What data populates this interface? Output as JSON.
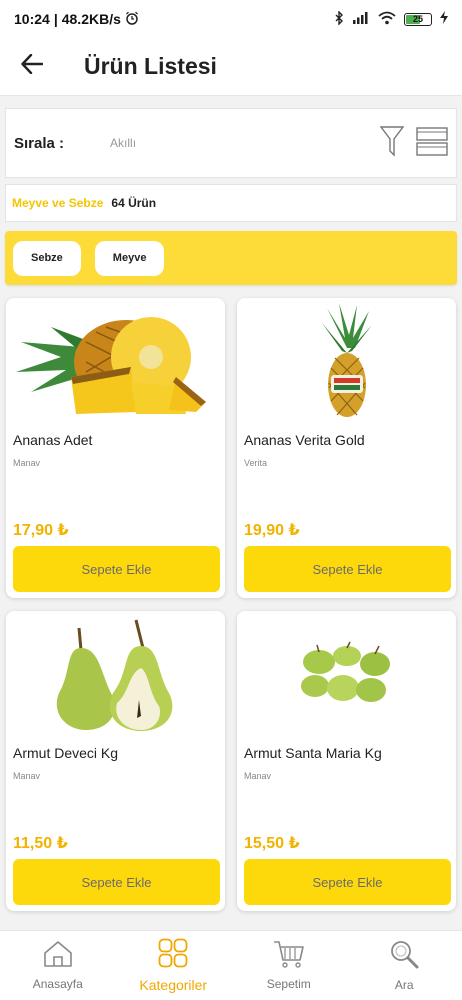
{
  "status_bar": {
    "time": "10:24",
    "speed": "48.2KB/s",
    "battery": "25"
  },
  "app_bar": {
    "title": "Ürün Listesi"
  },
  "sort": {
    "label": "Sırala :",
    "value": "Akıllı"
  },
  "category": {
    "name": "Meyve ve Sebze",
    "count": "64 Ürün"
  },
  "chips": [
    "Sebze",
    "Meyve"
  ],
  "products": [
    {
      "name": "Ananas Adet",
      "brand": "Manav",
      "price": "17,90 ₺",
      "button": "Sepete Ekle"
    },
    {
      "name": "Ananas Verita Gold",
      "brand": "Verita",
      "price": "19,90 ₺",
      "button": "Sepete Ekle"
    },
    {
      "name": "Armut Deveci Kg",
      "brand": "Manav",
      "price": "11,50 ₺",
      "button": "Sepete Ekle"
    },
    {
      "name": "Armut Santa Maria Kg",
      "brand": "Manav",
      "price": "15,50 ₺",
      "button": "Sepete Ekle"
    }
  ],
  "bottom_nav": [
    {
      "label": "Anasayfa",
      "icon": "home-icon"
    },
    {
      "label": "Kategoriler",
      "icon": "grid-icon",
      "active": true
    },
    {
      "label": "Sepetim",
      "icon": "cart-icon"
    },
    {
      "label": "Ara",
      "icon": "search-icon"
    }
  ],
  "colors": {
    "accent": "#fdd90c",
    "chip_bar": "#fddc3a",
    "price": "#f2b200",
    "active_nav": "#f0a800"
  }
}
